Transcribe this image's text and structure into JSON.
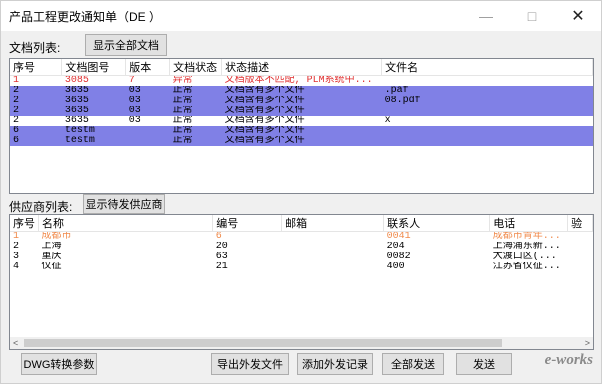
{
  "window": {
    "title": "产品工程更改通知单（DE    ）",
    "min_icon": "—",
    "max_icon": "□",
    "close_icon": "✕"
  },
  "documents": {
    "label": "文档列表:",
    "show_all_button": "显示全部文档",
    "columns": [
      "序号",
      "文档图号",
      "版本",
      "文档状态",
      "状态描述",
      "文件名"
    ],
    "rows": [
      {
        "seq": "1",
        "doc_no": "3085",
        "ver": "7",
        "status": "异常",
        "desc": "文档版本不匹配, PLM系统中...",
        "file": "",
        "style": "red"
      },
      {
        "seq": "2",
        "doc_no": "3635",
        "ver": "03",
        "status": "正常",
        "desc": "文档含有多个文件",
        "file": ".paf",
        "style": "sel"
      },
      {
        "seq": "2",
        "doc_no": "3635",
        "ver": "03",
        "status": "正常",
        "desc": "文档含有多个文件",
        "file": "08.pdf",
        "style": "sel"
      },
      {
        "seq": "2",
        "doc_no": "3635",
        "ver": "03",
        "status": "正常",
        "desc": "文档含有多个文件",
        "file": "",
        "style": "sel"
      },
      {
        "seq": "2",
        "doc_no": "3635",
        "ver": "03",
        "status": "正常",
        "desc": "文档含有多个文件",
        "file": "x",
        "style": "white"
      },
      {
        "seq": "6",
        "doc_no": "testm",
        "ver": "",
        "status": "正常",
        "desc": "文档含有多个文件",
        "file": "",
        "style": "sel"
      },
      {
        "seq": "6",
        "doc_no": "testm",
        "ver": "",
        "status": "正常",
        "desc": "文档含有多个文件",
        "file": "",
        "style": "sel"
      }
    ]
  },
  "suppliers": {
    "label": "供应商列表:",
    "show_pending_button": "显示待发供应商",
    "columns": [
      "序号",
      "名称",
      "编号",
      "邮箱",
      "联系人",
      "电话",
      "验"
    ],
    "rows": [
      {
        "seq": "1",
        "name": "成都市",
        "code": "6",
        "email": "",
        "contact": "0041",
        "phone": "成都市青年...",
        "style": "orange"
      },
      {
        "seq": "2",
        "name": "上海",
        "code": "20",
        "email": "",
        "contact": "204",
        "phone": "上海浦东新...",
        "style": "normal"
      },
      {
        "seq": "3",
        "name": "重庆",
        "code": "63",
        "email": "",
        "contact": "0082",
        "phone": "大渡口区(...",
        "style": "normal"
      },
      {
        "seq": "4",
        "name": "仪征",
        "code": "21",
        "email": "",
        "contact": "400",
        "phone": "江苏省仪征...",
        "style": "normal"
      }
    ],
    "scroll_left": "<",
    "scroll_right": ">"
  },
  "footer": {
    "dwg_button": "DWG转换参数",
    "export_button": "导出外发文件",
    "add_record_button": "添加外发记录",
    "send_all_button": "全部发送",
    "send_button": "发送"
  },
  "watermark": {
    "main": "e-works",
    "sub": ""
  }
}
